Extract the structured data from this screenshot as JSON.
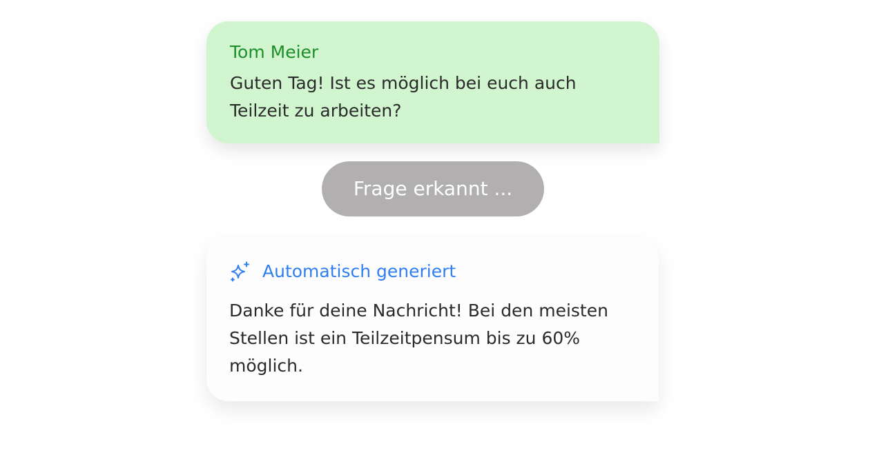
{
  "user_message": {
    "sender": "Tom Meier",
    "text": "Guten Tag! Ist es möglich bei euch auch\nTeilzeit zu arbeiten?"
  },
  "status": {
    "label": "Frage erkannt ..."
  },
  "auto_reply": {
    "icon": "sparkle-icon",
    "label": "Automatisch generiert",
    "text": "Danke für deine Nachricht!  Bei den meisten\nStellen ist ein Teilzeitpensum bis zu 60%\nmöglich."
  },
  "colors": {
    "user_bubble": "#d0f5cf",
    "sender_name": "#1e8e2b",
    "status_pill": "#b2afb0",
    "auto_label": "#2f7ff0",
    "body_text": "#2a2a2a"
  }
}
